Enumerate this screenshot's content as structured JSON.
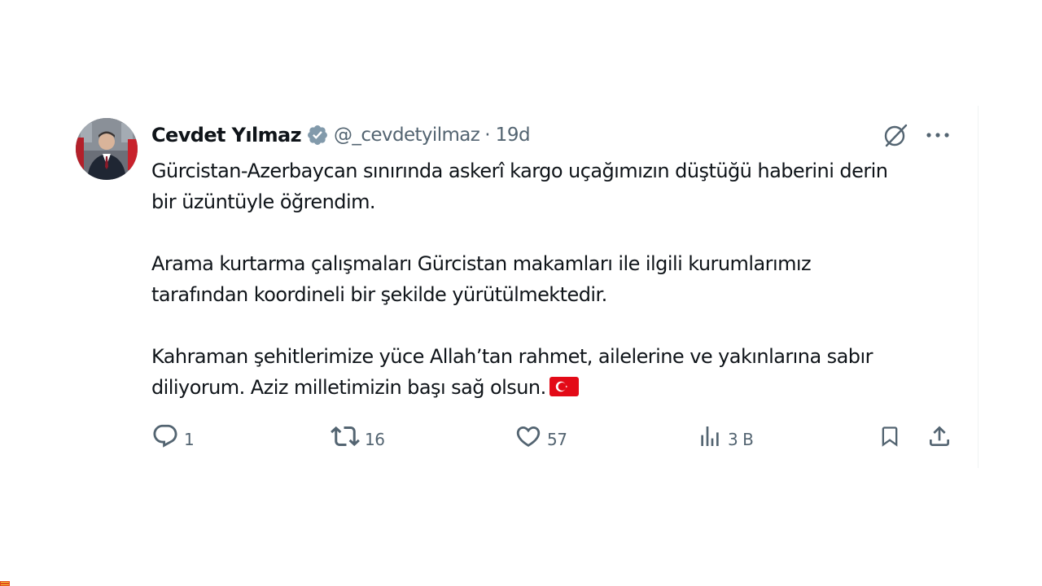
{
  "tweet": {
    "author": {
      "display_name": "Cevdet Yılmaz",
      "handle": "@_cevdetyilmaz",
      "verified": true
    },
    "separator": "·",
    "time": "19d",
    "paragraphs": [
      [
        "Gürcistan-Azerbaycan sınırında askerî kargo uçağımızın düştüğü haberini derin",
        "bir üzüntüyle öğrendim."
      ],
      [
        "Arama kurtarma çalışmaları Gürcistan makamları ile ilgili kurumlarımız",
        "tarafından koordineli bir şekilde yürütülmektedir."
      ],
      [
        "Kahraman şehitlerimize yüce Allah’tan rahmet, ailelerine ve yakınlarına sabır",
        "diliyorum. Aziz milletimizin başı sağ olsun."
      ]
    ],
    "flag": "turkey-flag-emoji"
  },
  "actions": {
    "reply_count": "1",
    "retweet_count": "16",
    "like_count": "57",
    "views_count": "3 В"
  },
  "icons": {
    "verified": "verified-badge-icon",
    "grok": "grok-icon",
    "more": "more-options-icon",
    "reply": "reply-icon",
    "retweet": "retweet-icon",
    "like": "heart-icon",
    "views": "views-icon",
    "bookmark": "bookmark-icon",
    "share": "share-icon"
  },
  "colors": {
    "text": "#0f1419",
    "secondary": "#536471",
    "verified_badge": "#829aab",
    "flag_red": "#e30a17"
  }
}
